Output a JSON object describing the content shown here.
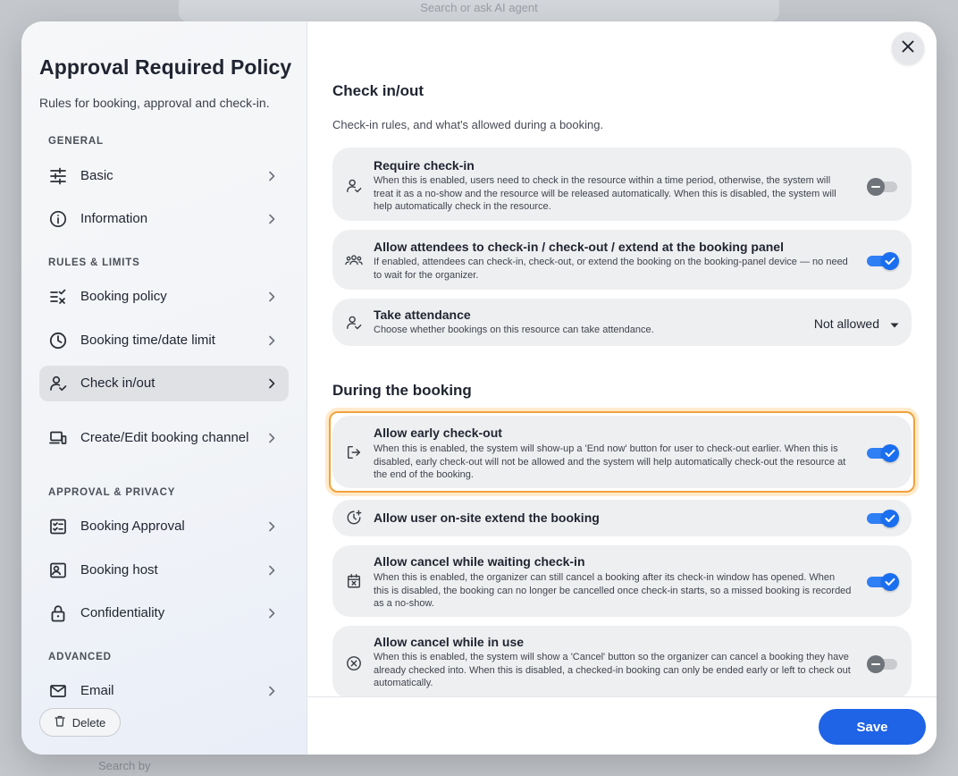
{
  "backdrop": {
    "search_text": "Search or ask AI agent",
    "bottom_text": "Search by"
  },
  "sidebar": {
    "title": "Approval Required Policy",
    "subtitle": "Rules for booking, approval and check-in.",
    "sections": {
      "general": "GENERAL",
      "rules_limits": "RULES & LIMITS",
      "approval_privacy": "APPROVAL & PRIVACY",
      "advanced": "ADVANCED"
    },
    "items": [
      {
        "label": "Basic",
        "icon": "sliders-icon"
      },
      {
        "label": "Information",
        "icon": "info-icon"
      },
      {
        "label": "Booking policy",
        "icon": "checklist-icon"
      },
      {
        "label": "Booking time/date limit",
        "icon": "clock-icon"
      },
      {
        "label": "Check in/out",
        "icon": "user-check-icon",
        "active": true
      },
      {
        "label": "Create/Edit booking channel",
        "icon": "devices-icon"
      },
      {
        "label": "Booking Approval",
        "icon": "approval-icon"
      },
      {
        "label": "Booking host",
        "icon": "host-icon"
      },
      {
        "label": "Confidentiality",
        "icon": "lock-icon"
      },
      {
        "label": "Email",
        "icon": "mail-icon"
      }
    ],
    "delete_label": "Delete"
  },
  "content": {
    "checkin_section": {
      "title": "Check in/out",
      "description": "Check-in rules, and what's allowed during a booking."
    },
    "cards_checkin": [
      {
        "title": "Require check-in",
        "description": "When this is enabled, users need to check in the resource within a time period, otherwise, the system will treat it as a no-show and the resource will be released automatically. When this is disabled, the system will help automatically check in the resource.",
        "enabled": false
      },
      {
        "title": "Allow attendees to check-in / check-out / extend at the booking panel",
        "description": "If enabled, attendees can check-in, check-out, or extend the booking on the booking-panel device — no need to wait for the organizer.",
        "enabled": true
      },
      {
        "title": "Take attendance",
        "description": "Choose whether bookings on this resource can take attendance.",
        "select_value": "Not allowed"
      }
    ],
    "during_section": {
      "title": "During the booking"
    },
    "cards_during": [
      {
        "title": "Allow early check-out",
        "description": "When this is enabled, the system will show-up a 'End now' button for user to check-out earlier. When this is disabled, early check-out will not be allowed and the system will help automatically check-out the resource at the end of the booking.",
        "enabled": true
      },
      {
        "title": "Allow user on-site extend the booking",
        "description": "",
        "enabled": true
      },
      {
        "title": "Allow cancel while waiting check-in",
        "description": "When this is enabled, the organizer can still cancel a booking after its check-in window has opened. When this is disabled, the booking can no longer be cancelled once check-in starts, so a missed booking is recorded as a no-show.",
        "enabled": true
      },
      {
        "title": "Allow cancel while in use",
        "description": "When this is enabled, the system will show a 'Cancel' button so the organizer can cancel a booking they have already checked into. When this is disabled, a checked-in booking can only be ended early or left to check out automatically.",
        "enabled": false
      }
    ]
  },
  "footer": {
    "save_label": "Save"
  },
  "colors": {
    "accent": "#1f63e6",
    "toggle_on": "#2f7ff5",
    "highlight": "#f0a23a",
    "active_item_bg": "#dfe1e5"
  }
}
